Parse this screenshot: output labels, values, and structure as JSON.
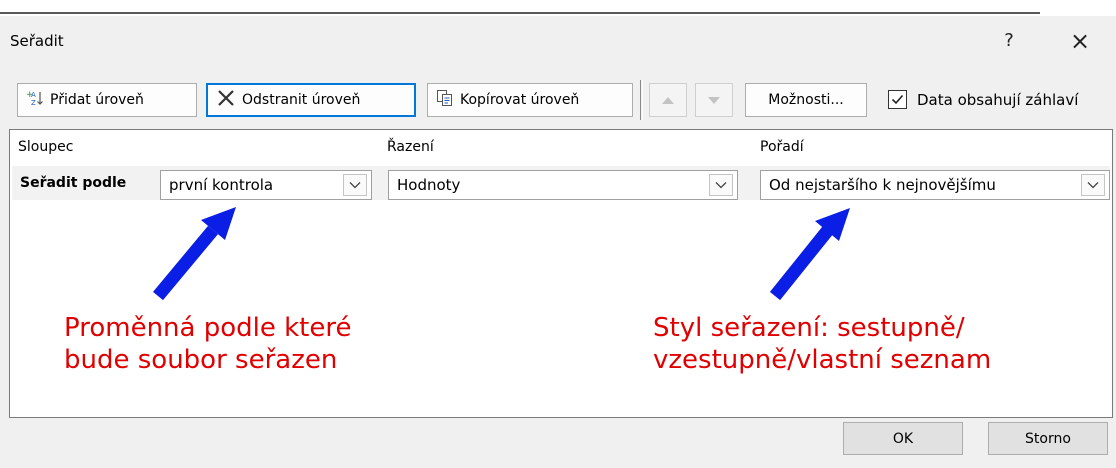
{
  "window": {
    "title": "Seřadit",
    "help": "?",
    "close": "×"
  },
  "toolbar": {
    "add_level": "Přidat úroveň",
    "delete_level": "Odstranit úroveň",
    "copy_level": "Kopírovat úroveň",
    "options": "Možnosti...",
    "header_checkbox_label": "Data obsahují záhlaví",
    "header_checkbox_checked": true
  },
  "columns": {
    "column": "Sloupec",
    "sort_on": "Řazení",
    "order": "Pořadí"
  },
  "level": {
    "label": "Seřadit podle",
    "column_value": "první kontrola",
    "sort_on_value": "Hodnoty",
    "order_value": "Od nejstaršího k nejnovějšímu"
  },
  "annotations": {
    "left_line1": "Proměnná podle které",
    "left_line2": "bude soubor seřazen",
    "right_line1": "Styl seřazení: sestupně/",
    "right_line2": "vzestupně/vlastní seznam"
  },
  "footer": {
    "ok": "OK",
    "cancel": "Storno"
  },
  "colors": {
    "accent": "#0078d7",
    "annotation": "#e00000",
    "arrow": "#0a1ee6"
  }
}
